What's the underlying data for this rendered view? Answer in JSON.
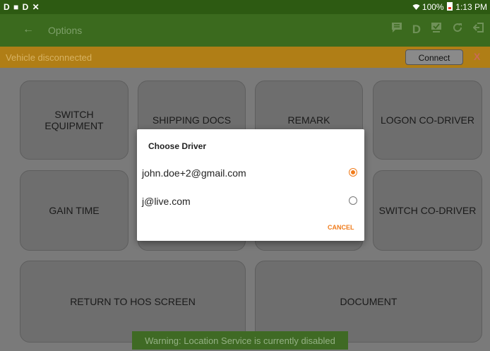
{
  "status_bar": {
    "left_icons": "D ■ D ✕",
    "wifi": "📶",
    "battery": "100%",
    "time": "1:13 PM"
  },
  "app_bar": {
    "back": "←",
    "title": "Options"
  },
  "alert": {
    "message": "Vehicle disconnected",
    "connect_label": "Connect",
    "dismiss": "X"
  },
  "tiles": {
    "switch_equipment": "SWITCH EQUIPMENT",
    "shipping_docs": "SHIPPING DOCS",
    "remark": "REMARK",
    "logon_codriver": "LOGON CO-DRIVER",
    "gain_time": "GAIN TIME",
    "switch_codriver": "SWITCH CO-DRIVER",
    "return_hos": "RETURN TO HOS SCREEN",
    "document": "DOCUMENT"
  },
  "dialog": {
    "title": "Choose Driver",
    "options": [
      {
        "label": "john.doe+2@gmail.com",
        "selected": true
      },
      {
        "label": "j@live.com",
        "selected": false
      }
    ],
    "cancel_label": "CANCEL"
  },
  "toast": "Warning: Location Service is currently disabled",
  "colors": {
    "app_bar": "#3b6a1e",
    "alert": "#b07e16",
    "accent": "#f07c1c"
  }
}
